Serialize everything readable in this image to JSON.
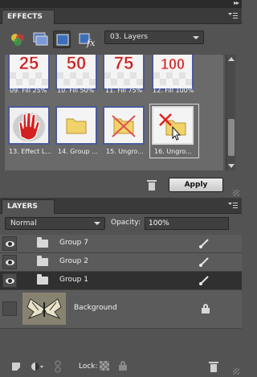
{
  "effects_panel": {
    "title": "EFFECTS",
    "category_dropdown": "03. Layers",
    "toolbar_icons": [
      "effects-icon",
      "layer-styles-icon",
      "photo-effects-icon",
      "filters-icon"
    ],
    "items": [
      {
        "caption": "09. Fill 25%",
        "graphic": "25"
      },
      {
        "caption": "10. Fill 50%",
        "graphic": "50"
      },
      {
        "caption": "11. Fill 75%",
        "graphic": "75"
      },
      {
        "caption": "12. Fill 100%",
        "graphic": "100"
      },
      {
        "caption": "13. Effect L...",
        "graphic": "hand"
      },
      {
        "caption": "14. Group ...",
        "graphic": "folder"
      },
      {
        "caption": "15. Ungro...",
        "graphic": "folder-x"
      },
      {
        "caption": "16. Ungro...",
        "graphic": "folder-x-cursor"
      }
    ],
    "apply_label": "Apply"
  },
  "layers_panel": {
    "title": "LAYERS",
    "blend_mode": "Normal",
    "opacity_label": "Opacity:",
    "opacity_value": "100%",
    "layers": [
      {
        "name": "Group 7",
        "type": "group",
        "visible": true
      },
      {
        "name": "Group 2",
        "type": "group",
        "visible": true
      },
      {
        "name": "Group 1",
        "type": "group",
        "visible": true,
        "active": true
      },
      {
        "name": "Background",
        "type": "image",
        "visible": false,
        "locked": true
      }
    ],
    "lock_label": "Lock:"
  },
  "colors": {
    "panel_bg": "#535353",
    "active_row": "#303030",
    "fill_text": "#c21a1a",
    "thumb_border": "#4a5a9a"
  }
}
